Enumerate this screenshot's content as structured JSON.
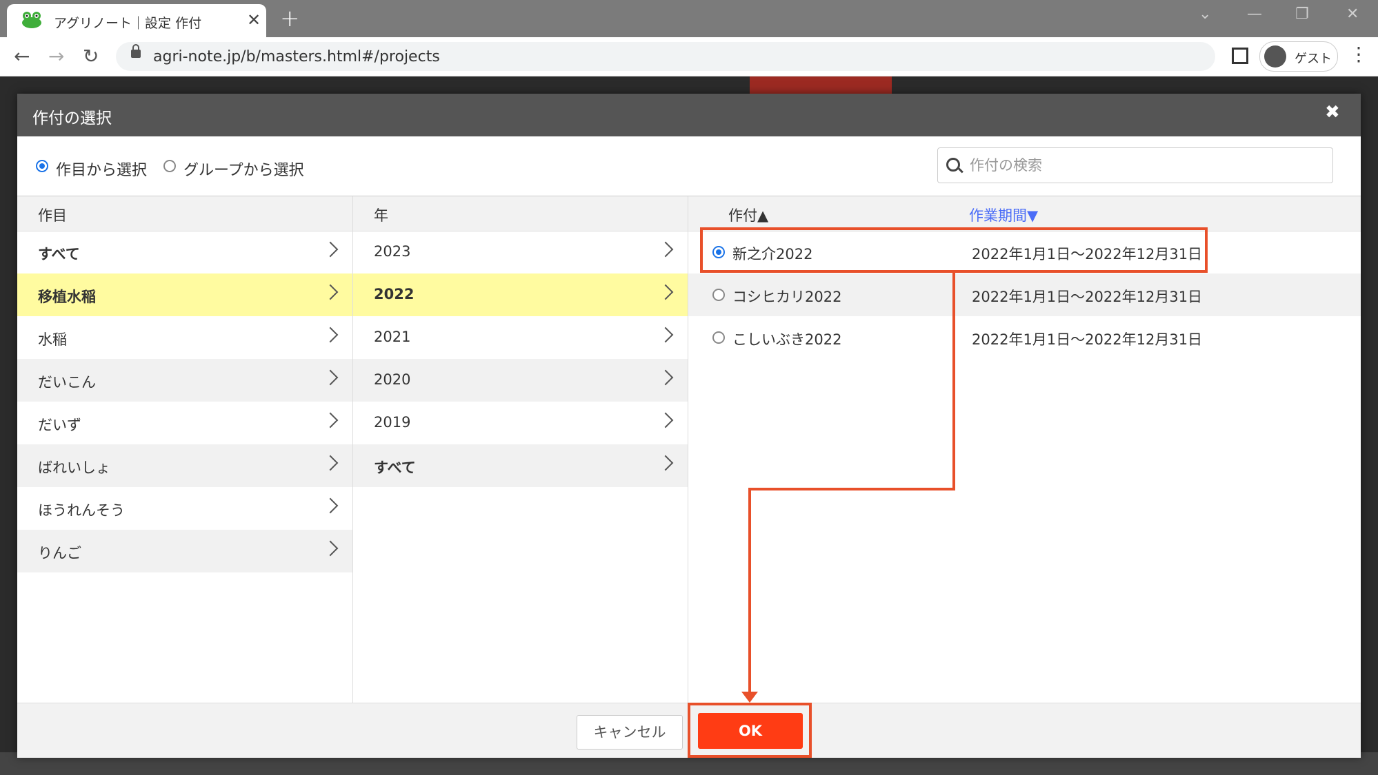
{
  "browser": {
    "tab_title": "アグリノート｜設定 作付",
    "tab_close": "✕",
    "new_tab": "+",
    "url": "agri-note.jp/b/masters.html#/projects",
    "profile_label": "ゲスト"
  },
  "modal": {
    "title": "作付の選択",
    "close": "✖",
    "mode_options": [
      "作目から選択",
      "グループから選択"
    ],
    "selected_mode": "作目から選択",
    "search_placeholder": "作付の検索",
    "columns": {
      "crop": {
        "header": "作目",
        "items": [
          "すべて",
          "移植水稲",
          "水稲",
          "だいこん",
          "だいず",
          "ばれいしょ",
          "ほうれんそう",
          "りんご"
        ],
        "selected": "移植水稲"
      },
      "year": {
        "header": "年",
        "items": [
          "2023",
          "2022",
          "2021",
          "2020",
          "2019",
          "すべて"
        ],
        "selected": "2022"
      },
      "project": {
        "header_name": "作付▲",
        "header_period": "作業期間▼",
        "items": [
          {
            "name": "新之介2022",
            "period": "2022年1月1日～2022年12月31日",
            "selected": true
          },
          {
            "name": "コシヒカリ2022",
            "period": "2022年1月1日～2022年12月31日",
            "selected": false
          },
          {
            "name": "こしいぶき2022",
            "period": "2022年1月1日～2022年12月31日",
            "selected": false
          }
        ]
      }
    },
    "cancel_label": "キャンセル",
    "ok_label": "OK"
  },
  "colors": {
    "accent_blue": "#1a73e8",
    "selected_row": "#fffba0",
    "ok_button": "#ff3c14",
    "annotation": "#e8502a",
    "period_header": "#4a6cf7"
  }
}
